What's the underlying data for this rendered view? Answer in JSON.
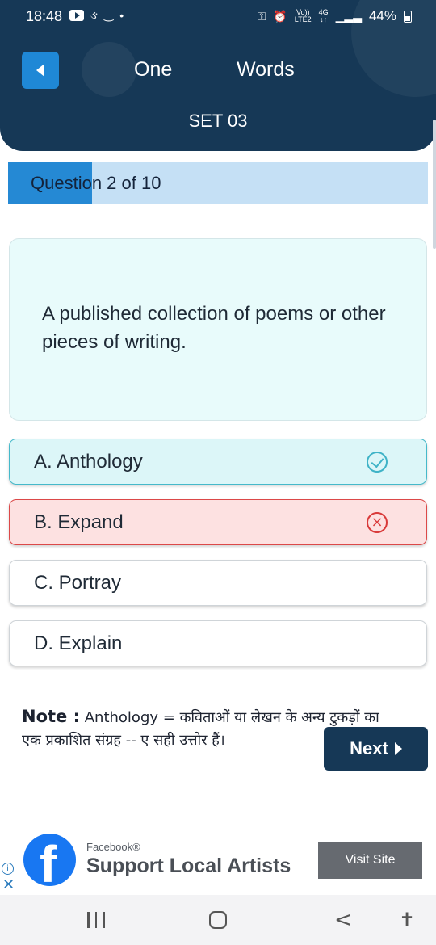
{
  "status_bar": {
    "time": "18:48",
    "network_top": "Vo))",
    "network_bottom": "LTE2",
    "signal_type_top": "4G",
    "signal_type_bottom": "↓↑",
    "battery": "44%"
  },
  "header": {
    "title_left": "One",
    "title_right": "Words",
    "set_label": "SET 03",
    "back_icon": "back-arrow-icon"
  },
  "progress": {
    "label": "Question 2 of 10",
    "current": 2,
    "total": 10,
    "fraction": 0.2
  },
  "question": {
    "text": "A published collection of poems or other pieces of writing."
  },
  "options": [
    {
      "label": "A. Anthology",
      "state": "correct"
    },
    {
      "label": "B. Expand",
      "state": "wrong"
    },
    {
      "label": "C. Portray",
      "state": "neutral"
    },
    {
      "label": "D. Explain",
      "state": "neutral"
    }
  ],
  "note": {
    "heading": "Note :",
    "word": "Anthology",
    "line1_rest": "= कविताओं या लेखन के अन्य टुकड़ों का",
    "line2": "एक प्रकाशित संग्रह  -- ए सही उत्तोर हैं।"
  },
  "next_button": {
    "label": "Next"
  },
  "ad": {
    "brand": "Facebook®",
    "title": "Support Local Artists",
    "cta": "Visit Site",
    "logo_letter": "f",
    "info_icon": "i",
    "close_icon": "✕"
  },
  "colors": {
    "header_bg": "#163856",
    "accent": "#2589d4",
    "correct": "#45b9ca",
    "wrong": "#dc4848"
  }
}
